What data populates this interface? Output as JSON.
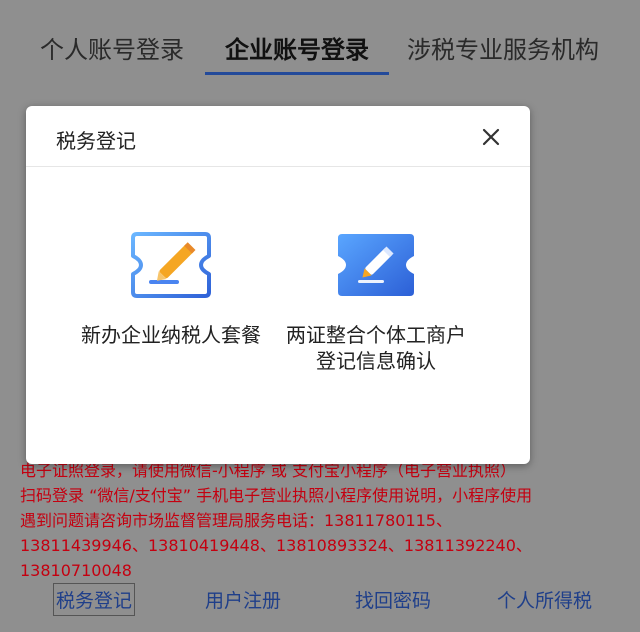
{
  "tabs": [
    {
      "label": "个人账号登录"
    },
    {
      "label": "企业账号登录"
    },
    {
      "label": "涉税专业服务机构"
    }
  ],
  "notice": {
    "lines": [
      "电子证照登录，请使用微信-小程序 或 支付宝小程序（电子营业执照）",
      "扫码登录 “微信/支付宝” 手机电子营业执照小程序使用说明，小程序使用",
      "遇到问题请咨询市场监督管理局服务电话：13811780115、",
      "13811439946、13810419448、13810893324、13811392240、",
      "13810710048"
    ]
  },
  "footer_links": [
    {
      "label": "税务登记"
    },
    {
      "label": "用户注册"
    },
    {
      "label": "找回密码"
    },
    {
      "label": "个人所得税"
    }
  ],
  "modal": {
    "title": "税务登记",
    "close_icon": "close-icon",
    "options": [
      {
        "label": "新办企业纳税人套餐",
        "icon": "edit-ticket-icon"
      },
      {
        "label": "两证整合个体工商户登记信息确认",
        "icon": "edit-ticket-icon"
      }
    ]
  },
  "colors": {
    "overlay": "#8f8f8f",
    "active_tab_underline": "#234a9a",
    "notice_text": "#c40010",
    "link_text": "#1f3f8a",
    "icon_blue": "#4a84f0",
    "icon_orange": "#f5a623"
  }
}
